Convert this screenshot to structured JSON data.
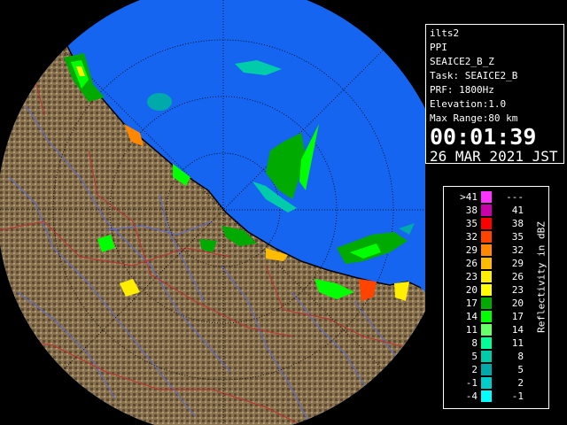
{
  "info": {
    "site": "ilts2",
    "mode": "PPI",
    "product": "SEAICE2_B_Z",
    "task": "Task: SEAICE2_B",
    "prf": "PRF: 1800Hz",
    "elevation": "Elevation:1.0",
    "max_range": "Max Range:80 km",
    "time": "00:01:39",
    "date": "26 MAR 2021 JST"
  },
  "legend": {
    "unit": "Reflectivity in dBZ",
    "rows": [
      {
        "left": ">41",
        "right": "---",
        "color": "#ff33ff"
      },
      {
        "left": "38",
        "right": "41",
        "color": "#cc00aa"
      },
      {
        "left": "35",
        "right": "38",
        "color": "#ff0000"
      },
      {
        "left": "32",
        "right": "35",
        "color": "#ff4400"
      },
      {
        "left": "29",
        "right": "32",
        "color": "#ff8800"
      },
      {
        "left": "26",
        "right": "29",
        "color": "#ffbb00"
      },
      {
        "left": "23",
        "right": "26",
        "color": "#ffee00"
      },
      {
        "left": "20",
        "right": "23",
        "color": "#ffff00"
      },
      {
        "left": "17",
        "right": "20",
        "color": "#00aa00"
      },
      {
        "left": "14",
        "right": "17",
        "color": "#00ff00"
      },
      {
        "left": "11",
        "right": "14",
        "color": "#66ff66"
      },
      {
        "left": "8",
        "right": "11",
        "color": "#00ff99"
      },
      {
        "left": "5",
        "right": "8",
        "color": "#00ccaa"
      },
      {
        "left": "2",
        "right": "5",
        "color": "#00aaaa"
      },
      {
        "left": "-1",
        "right": "2",
        "color": "#00cccc"
      },
      {
        "left": "-4",
        "right": "-1",
        "color": "#00ffff"
      }
    ]
  },
  "colors": {
    "sea": "#1565f0",
    "land": "#8a7350",
    "rivers": "#5a6ad8",
    "boundaries": "#c03030",
    "coastline": "#000000",
    "outside_range": "#000000"
  }
}
